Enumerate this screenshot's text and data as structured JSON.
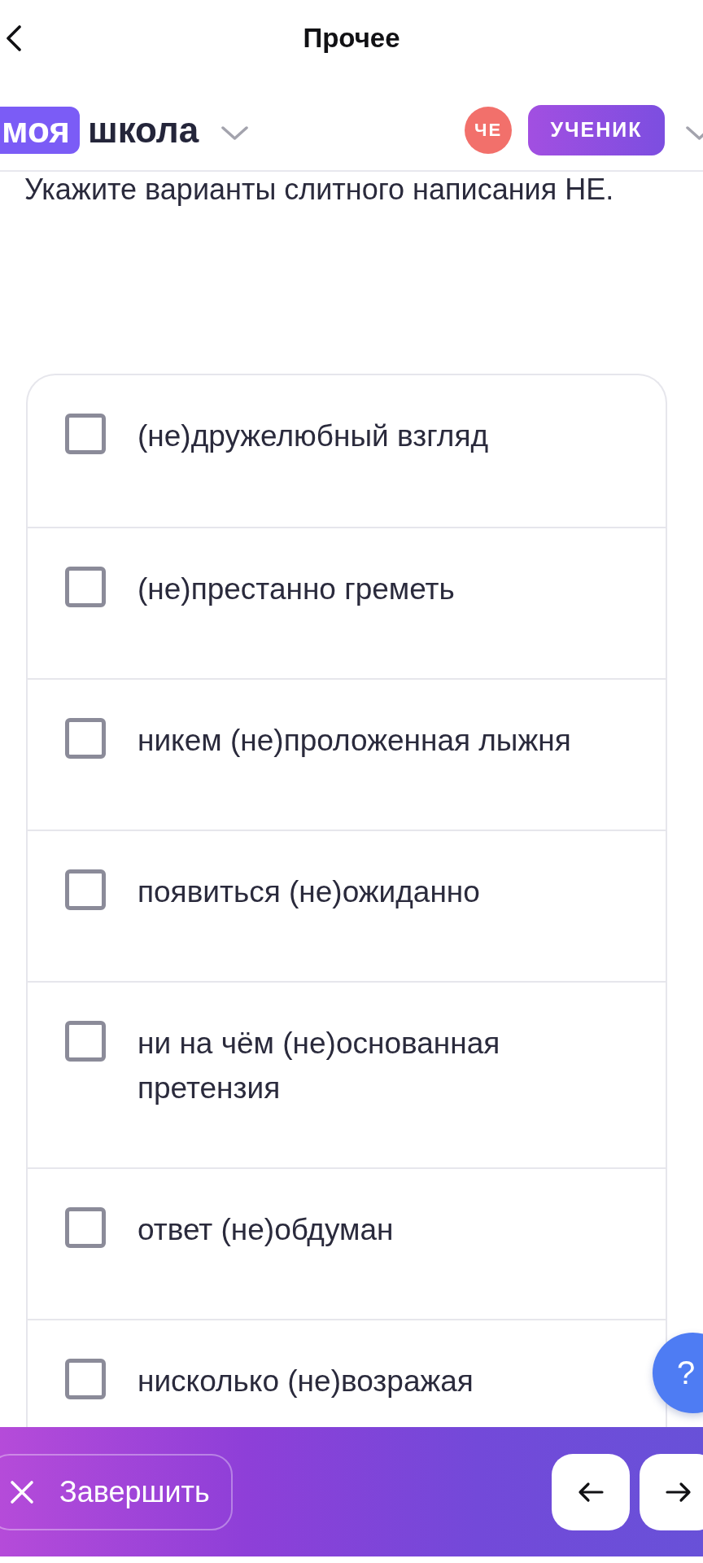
{
  "nav": {
    "title": "Прочее"
  },
  "header": {
    "logo_badge": "моя",
    "logo_text": "школа",
    "avatar_initials": "ЧЕ",
    "role": "УЧЕНИК"
  },
  "question": {
    "prompt": "Укажите варианты слитного написания НЕ.",
    "options": [
      {
        "text": "(не)дружелюбный взгляд",
        "checked": false
      },
      {
        "text": "(не)престанно греметь",
        "checked": false
      },
      {
        "text": "никем (не)проложенная лыжня",
        "checked": false
      },
      {
        "text": "появиться (не)ожиданно",
        "checked": false
      },
      {
        "text": "ни на чём (не)основанная претензия",
        "checked": false
      },
      {
        "text": "ответ (не)обдуман",
        "checked": false
      },
      {
        "text": "нисколько (не)возражая",
        "checked": false
      }
    ]
  },
  "help_button": {
    "label": "?"
  },
  "footer": {
    "finish_button": "Завершить"
  }
}
